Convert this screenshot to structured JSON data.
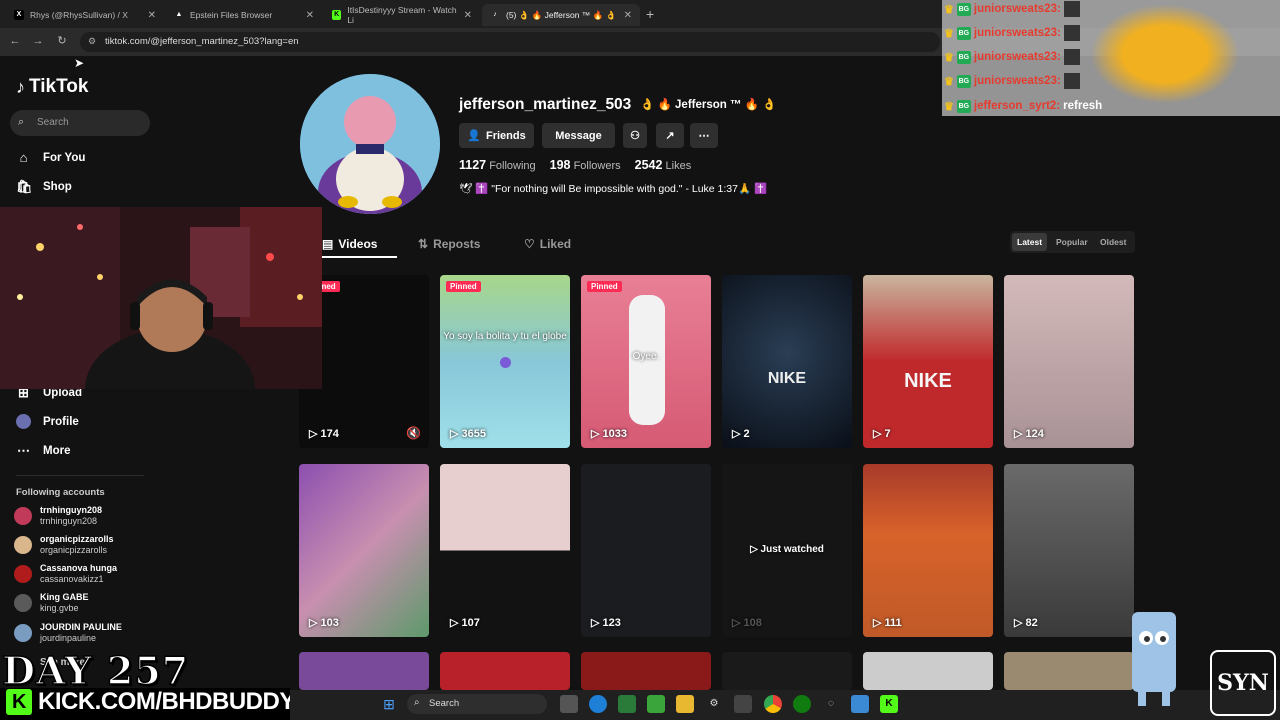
{
  "browser": {
    "tabs": [
      {
        "title": "Rhys (@RhysSullivan) / X",
        "favicon": "x-logo-icon",
        "active": false
      },
      {
        "title": "Epstein Files Browser",
        "favicon": "triangle-icon",
        "active": false
      },
      {
        "title": "ItIsDestinyyy Stream - Watch Li",
        "favicon": "kick-logo-icon",
        "active": false
      },
      {
        "title": "(5) 👌 🔥 Jefferson ™ 🔥 👌",
        "favicon": "tiktok-icon",
        "active": true
      }
    ],
    "new_tab": "+",
    "url": "tiktok.com/@jefferson_martinez_503?lang=en"
  },
  "sidebar": {
    "logo": "TikTok",
    "search_placeholder": "Search",
    "nav": [
      {
        "label": "For You",
        "icon": "home-icon"
      },
      {
        "label": "Shop",
        "icon": "shopping-bag-icon"
      },
      {
        "label": "Upload",
        "icon": "upload-icon"
      },
      {
        "label": "Profile",
        "icon": "profile-icon"
      },
      {
        "label": "More",
        "icon": "more-icon"
      }
    ],
    "following_title": "Following accounts",
    "following": [
      {
        "name": "trnhinguyn208",
        "handle": "trnhinguyn208",
        "color": "#c23a5a"
      },
      {
        "name": "organicpizzarolls",
        "handle": "organicpizzarolls",
        "color": "#d9b68c"
      },
      {
        "name": "Cassanova hunga",
        "handle": "cassanovakizz1",
        "color": "#b01c1c"
      },
      {
        "name": "King GABE",
        "handle": "king.gvbe",
        "color": "#5a5a5a"
      },
      {
        "name": "JOURDIN PAULINE",
        "handle": "jourdinpauline",
        "color": "#7a9cc0"
      }
    ],
    "see_more": "See more"
  },
  "profile": {
    "username": "jefferson_martinez_503",
    "display_name": "👌 🔥 Jefferson ™ 🔥 👌",
    "buttons": {
      "friends": "Friends",
      "message": "Message"
    },
    "stats": {
      "following": "1127",
      "following_label": "Following",
      "followers": "198",
      "followers_label": "Followers",
      "likes": "2542",
      "likes_label": "Likes"
    },
    "bio": "🕊 ✝️ \"For nothing will Be impossible with god.\" - Luke 1:37🙏 ✝️",
    "tabs": [
      "Videos",
      "Reposts",
      "Liked"
    ],
    "sort": [
      "Latest",
      "Popular",
      "Oldest"
    ]
  },
  "videos": [
    {
      "views": "174",
      "pinned": "Pinned",
      "text": "",
      "bg": "#0c0c0c"
    },
    {
      "views": "3655",
      "pinned": "Pinned",
      "text": "Yo soy la bolita y tu el globe",
      "bg": "#88c7d8"
    },
    {
      "views": "1033",
      "pinned": "Pinned",
      "text": "Oyee.",
      "bg": "#e06a82"
    },
    {
      "views": "2",
      "pinned": "",
      "text": "",
      "bg": "#1e2a3a"
    },
    {
      "views": "7",
      "pinned": "",
      "text": "",
      "bg": "#8a3a3a"
    },
    {
      "views": "124",
      "pinned": "",
      "text": "",
      "bg": "#b9a0a3"
    },
    {
      "views": "103",
      "pinned": "",
      "text": "",
      "bg": "#8a6aa0"
    },
    {
      "views": "107",
      "pinned": "",
      "text": "",
      "bg": "#d8b5b5"
    },
    {
      "views": "123",
      "pinned": "",
      "text": "",
      "bg": "#1a1c20"
    },
    {
      "views": "108",
      "pinned": "",
      "text": "Just watched",
      "bg": "#151515"
    },
    {
      "views": "111",
      "pinned": "",
      "text": "",
      "bg": "#c8582a"
    },
    {
      "views": "82",
      "pinned": "",
      "text": "",
      "bg": "#5a5a5a"
    }
  ],
  "chat": [
    {
      "user": "juniorsweats23:",
      "msg": ""
    },
    {
      "user": "juniorsweats23:",
      "msg": ""
    },
    {
      "user": "juniorsweats23:",
      "msg": ""
    },
    {
      "user": "juniorsweats23:",
      "msg": ""
    },
    {
      "user": "jefferson_syrt2:",
      "msg": "refresh"
    }
  ],
  "stream": {
    "day": "DAY 257",
    "kick_url": "KICK.COM/BHDBUDDY",
    "kick_letter": "K",
    "corner_logo": "SYN"
  },
  "taskbar": {
    "search": "Search"
  }
}
